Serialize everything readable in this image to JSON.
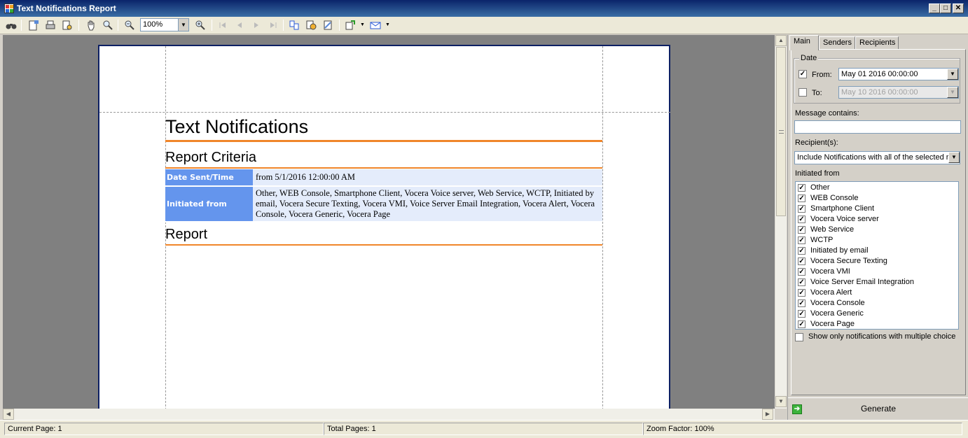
{
  "window": {
    "title": "Text Notifications Report",
    "minimize": "_",
    "maximize": "□",
    "close": "✕"
  },
  "toolbar": {
    "zoom_value": "100%",
    "icons": [
      "find-icon",
      "page-setup-icon",
      "print-icon",
      "print-preview-icon",
      "hand-tool-icon",
      "magnifier-icon",
      "zoom-out-icon",
      "zoom-in-icon",
      "first-page-icon",
      "prev-page-icon",
      "next-page-icon",
      "last-page-icon",
      "multi-page-icon",
      "color-icon",
      "watermark-icon",
      "export-icon",
      "email-icon"
    ]
  },
  "report": {
    "title": "Text Notifications",
    "criteria_heading": "Report Criteria",
    "criteria": [
      {
        "label": "Date Sent/Time",
        "value": "from 5/1/2016 12:00:00 AM"
      },
      {
        "label": "Initiated from",
        "value": "Other, WEB Console, Smartphone Client, Vocera Voice server, Web Service, WCTP, Initiated by email, Vocera Secure Texting, Vocera VMI, Voice Server Email Integration, Vocera Alert, Vocera Console, Vocera Generic, Vocera Page"
      }
    ],
    "report_heading": "Report"
  },
  "panel": {
    "tabs": [
      "Main",
      "Senders",
      "Recipients"
    ],
    "active_tab": "Main",
    "date_group": "Date",
    "from_label": "From:",
    "from_checked": true,
    "from_value": "May 01 2016 00:00:00",
    "to_label": "To:",
    "to_checked": false,
    "to_value": "May 10 2016 00:00:00",
    "message_label": "Message contains:",
    "message_value": "",
    "recipients_label": "Recipient(s):",
    "recipients_value": "Include Notifications with all of the selected re",
    "initiated_label": "Initiated from",
    "initiated_items": [
      "Other",
      "WEB Console",
      "Smartphone Client",
      "Vocera Voice server",
      "Web Service",
      "WCTP",
      "Initiated by email",
      "Vocera Secure Texting",
      "Vocera VMI",
      "Voice Server Email Integration",
      "Vocera Alert",
      "Vocera Console",
      "Vocera Generic",
      "Vocera Page"
    ],
    "multiple_choice_label": "Show only notifications with multiple choice",
    "multiple_choice_checked": false,
    "generate_label": "Generate"
  },
  "status": {
    "current_page": "Current Page: 1",
    "total_pages": "Total Pages: 1",
    "zoom_factor": "Zoom Factor: 100%"
  },
  "colors": {
    "accent_orange": "#f0862a",
    "criteria_label_bg": "#6495ed",
    "criteria_value_bg": "#e4ecfb",
    "titlebar": "#0a246a"
  }
}
